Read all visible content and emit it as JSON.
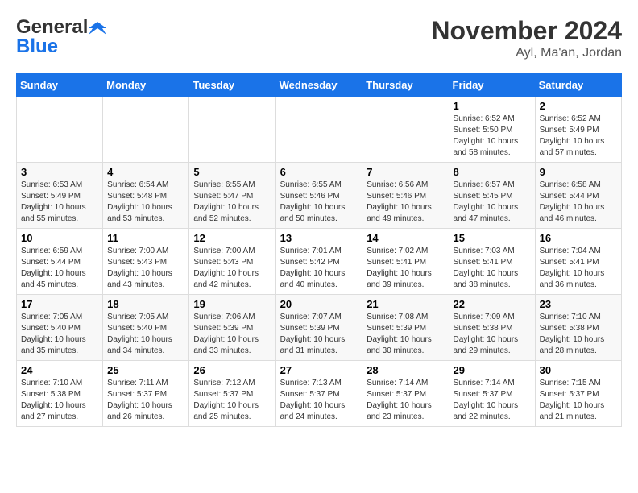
{
  "header": {
    "logo_general": "General",
    "logo_blue": "Blue",
    "month": "November 2024",
    "location": "Ayl, Ma'an, Jordan"
  },
  "calendar": {
    "days_of_week": [
      "Sunday",
      "Monday",
      "Tuesday",
      "Wednesday",
      "Thursday",
      "Friday",
      "Saturday"
    ],
    "weeks": [
      [
        {
          "day": "",
          "info": ""
        },
        {
          "day": "",
          "info": ""
        },
        {
          "day": "",
          "info": ""
        },
        {
          "day": "",
          "info": ""
        },
        {
          "day": "",
          "info": ""
        },
        {
          "day": "1",
          "info": "Sunrise: 6:52 AM\nSunset: 5:50 PM\nDaylight: 10 hours and 58 minutes."
        },
        {
          "day": "2",
          "info": "Sunrise: 6:52 AM\nSunset: 5:49 PM\nDaylight: 10 hours and 57 minutes."
        }
      ],
      [
        {
          "day": "3",
          "info": "Sunrise: 6:53 AM\nSunset: 5:49 PM\nDaylight: 10 hours and 55 minutes."
        },
        {
          "day": "4",
          "info": "Sunrise: 6:54 AM\nSunset: 5:48 PM\nDaylight: 10 hours and 53 minutes."
        },
        {
          "day": "5",
          "info": "Sunrise: 6:55 AM\nSunset: 5:47 PM\nDaylight: 10 hours and 52 minutes."
        },
        {
          "day": "6",
          "info": "Sunrise: 6:55 AM\nSunset: 5:46 PM\nDaylight: 10 hours and 50 minutes."
        },
        {
          "day": "7",
          "info": "Sunrise: 6:56 AM\nSunset: 5:46 PM\nDaylight: 10 hours and 49 minutes."
        },
        {
          "day": "8",
          "info": "Sunrise: 6:57 AM\nSunset: 5:45 PM\nDaylight: 10 hours and 47 minutes."
        },
        {
          "day": "9",
          "info": "Sunrise: 6:58 AM\nSunset: 5:44 PM\nDaylight: 10 hours and 46 minutes."
        }
      ],
      [
        {
          "day": "10",
          "info": "Sunrise: 6:59 AM\nSunset: 5:44 PM\nDaylight: 10 hours and 45 minutes."
        },
        {
          "day": "11",
          "info": "Sunrise: 7:00 AM\nSunset: 5:43 PM\nDaylight: 10 hours and 43 minutes."
        },
        {
          "day": "12",
          "info": "Sunrise: 7:00 AM\nSunset: 5:43 PM\nDaylight: 10 hours and 42 minutes."
        },
        {
          "day": "13",
          "info": "Sunrise: 7:01 AM\nSunset: 5:42 PM\nDaylight: 10 hours and 40 minutes."
        },
        {
          "day": "14",
          "info": "Sunrise: 7:02 AM\nSunset: 5:41 PM\nDaylight: 10 hours and 39 minutes."
        },
        {
          "day": "15",
          "info": "Sunrise: 7:03 AM\nSunset: 5:41 PM\nDaylight: 10 hours and 38 minutes."
        },
        {
          "day": "16",
          "info": "Sunrise: 7:04 AM\nSunset: 5:41 PM\nDaylight: 10 hours and 36 minutes."
        }
      ],
      [
        {
          "day": "17",
          "info": "Sunrise: 7:05 AM\nSunset: 5:40 PM\nDaylight: 10 hours and 35 minutes."
        },
        {
          "day": "18",
          "info": "Sunrise: 7:05 AM\nSunset: 5:40 PM\nDaylight: 10 hours and 34 minutes."
        },
        {
          "day": "19",
          "info": "Sunrise: 7:06 AM\nSunset: 5:39 PM\nDaylight: 10 hours and 33 minutes."
        },
        {
          "day": "20",
          "info": "Sunrise: 7:07 AM\nSunset: 5:39 PM\nDaylight: 10 hours and 31 minutes."
        },
        {
          "day": "21",
          "info": "Sunrise: 7:08 AM\nSunset: 5:39 PM\nDaylight: 10 hours and 30 minutes."
        },
        {
          "day": "22",
          "info": "Sunrise: 7:09 AM\nSunset: 5:38 PM\nDaylight: 10 hours and 29 minutes."
        },
        {
          "day": "23",
          "info": "Sunrise: 7:10 AM\nSunset: 5:38 PM\nDaylight: 10 hours and 28 minutes."
        }
      ],
      [
        {
          "day": "24",
          "info": "Sunrise: 7:10 AM\nSunset: 5:38 PM\nDaylight: 10 hours and 27 minutes."
        },
        {
          "day": "25",
          "info": "Sunrise: 7:11 AM\nSunset: 5:37 PM\nDaylight: 10 hours and 26 minutes."
        },
        {
          "day": "26",
          "info": "Sunrise: 7:12 AM\nSunset: 5:37 PM\nDaylight: 10 hours and 25 minutes."
        },
        {
          "day": "27",
          "info": "Sunrise: 7:13 AM\nSunset: 5:37 PM\nDaylight: 10 hours and 24 minutes."
        },
        {
          "day": "28",
          "info": "Sunrise: 7:14 AM\nSunset: 5:37 PM\nDaylight: 10 hours and 23 minutes."
        },
        {
          "day": "29",
          "info": "Sunrise: 7:14 AM\nSunset: 5:37 PM\nDaylight: 10 hours and 22 minutes."
        },
        {
          "day": "30",
          "info": "Sunrise: 7:15 AM\nSunset: 5:37 PM\nDaylight: 10 hours and 21 minutes."
        }
      ]
    ]
  }
}
